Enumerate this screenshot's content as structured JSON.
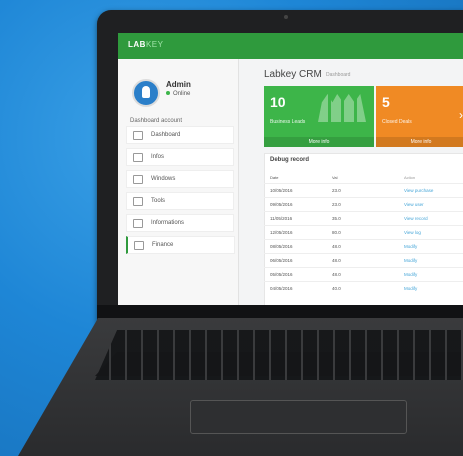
{
  "app": {
    "logo": "LAB",
    "logo_suffix": "KEY",
    "title": "Labkey CRM",
    "subtitle": "Dashboard"
  },
  "user": {
    "name": "Admin",
    "status": "Online"
  },
  "sidebar": {
    "section_title": "Dashboard account",
    "items": [
      {
        "label": "Dashboard",
        "icon": "dashboard-icon"
      },
      {
        "label": "Infos",
        "icon": "info-icon"
      },
      {
        "label": "Windows",
        "icon": "window-icon"
      },
      {
        "label": "Tools",
        "icon": "tools-icon"
      },
      {
        "label": "Informations",
        "icon": "id-card-icon"
      },
      {
        "label": "Finance",
        "icon": "finance-icon"
      }
    ]
  },
  "tiles": [
    {
      "value": "10",
      "label": "Business Leads",
      "footer": "More info",
      "color": "#3db549"
    },
    {
      "value": "5",
      "label": "Closed Deals",
      "footer": "More info",
      "color": "#f08a24"
    }
  ],
  "panel": {
    "title": "Debug record",
    "columns": [
      "Date",
      "Val",
      "Action"
    ],
    "rows": [
      {
        "date": "10/05/2016",
        "val": "23.0",
        "action": "View purchase"
      },
      {
        "date": "09/05/2016",
        "val": "23.0",
        "action": "View user"
      },
      {
        "date": "11/05/2016",
        "val": "35.0",
        "action": "View record"
      },
      {
        "date": "12/05/2016",
        "val": "80.0",
        "action": "View log"
      },
      {
        "date": "08/05/2016",
        "val": "48.0",
        "action": "Modify"
      },
      {
        "date": "06/05/2016",
        "val": "48.0",
        "action": "Modify"
      },
      {
        "date": "05/05/2016",
        "val": "48.0",
        "action": "Modify"
      },
      {
        "date": "04/05/2016",
        "val": "40.0",
        "action": "Modify"
      }
    ]
  }
}
